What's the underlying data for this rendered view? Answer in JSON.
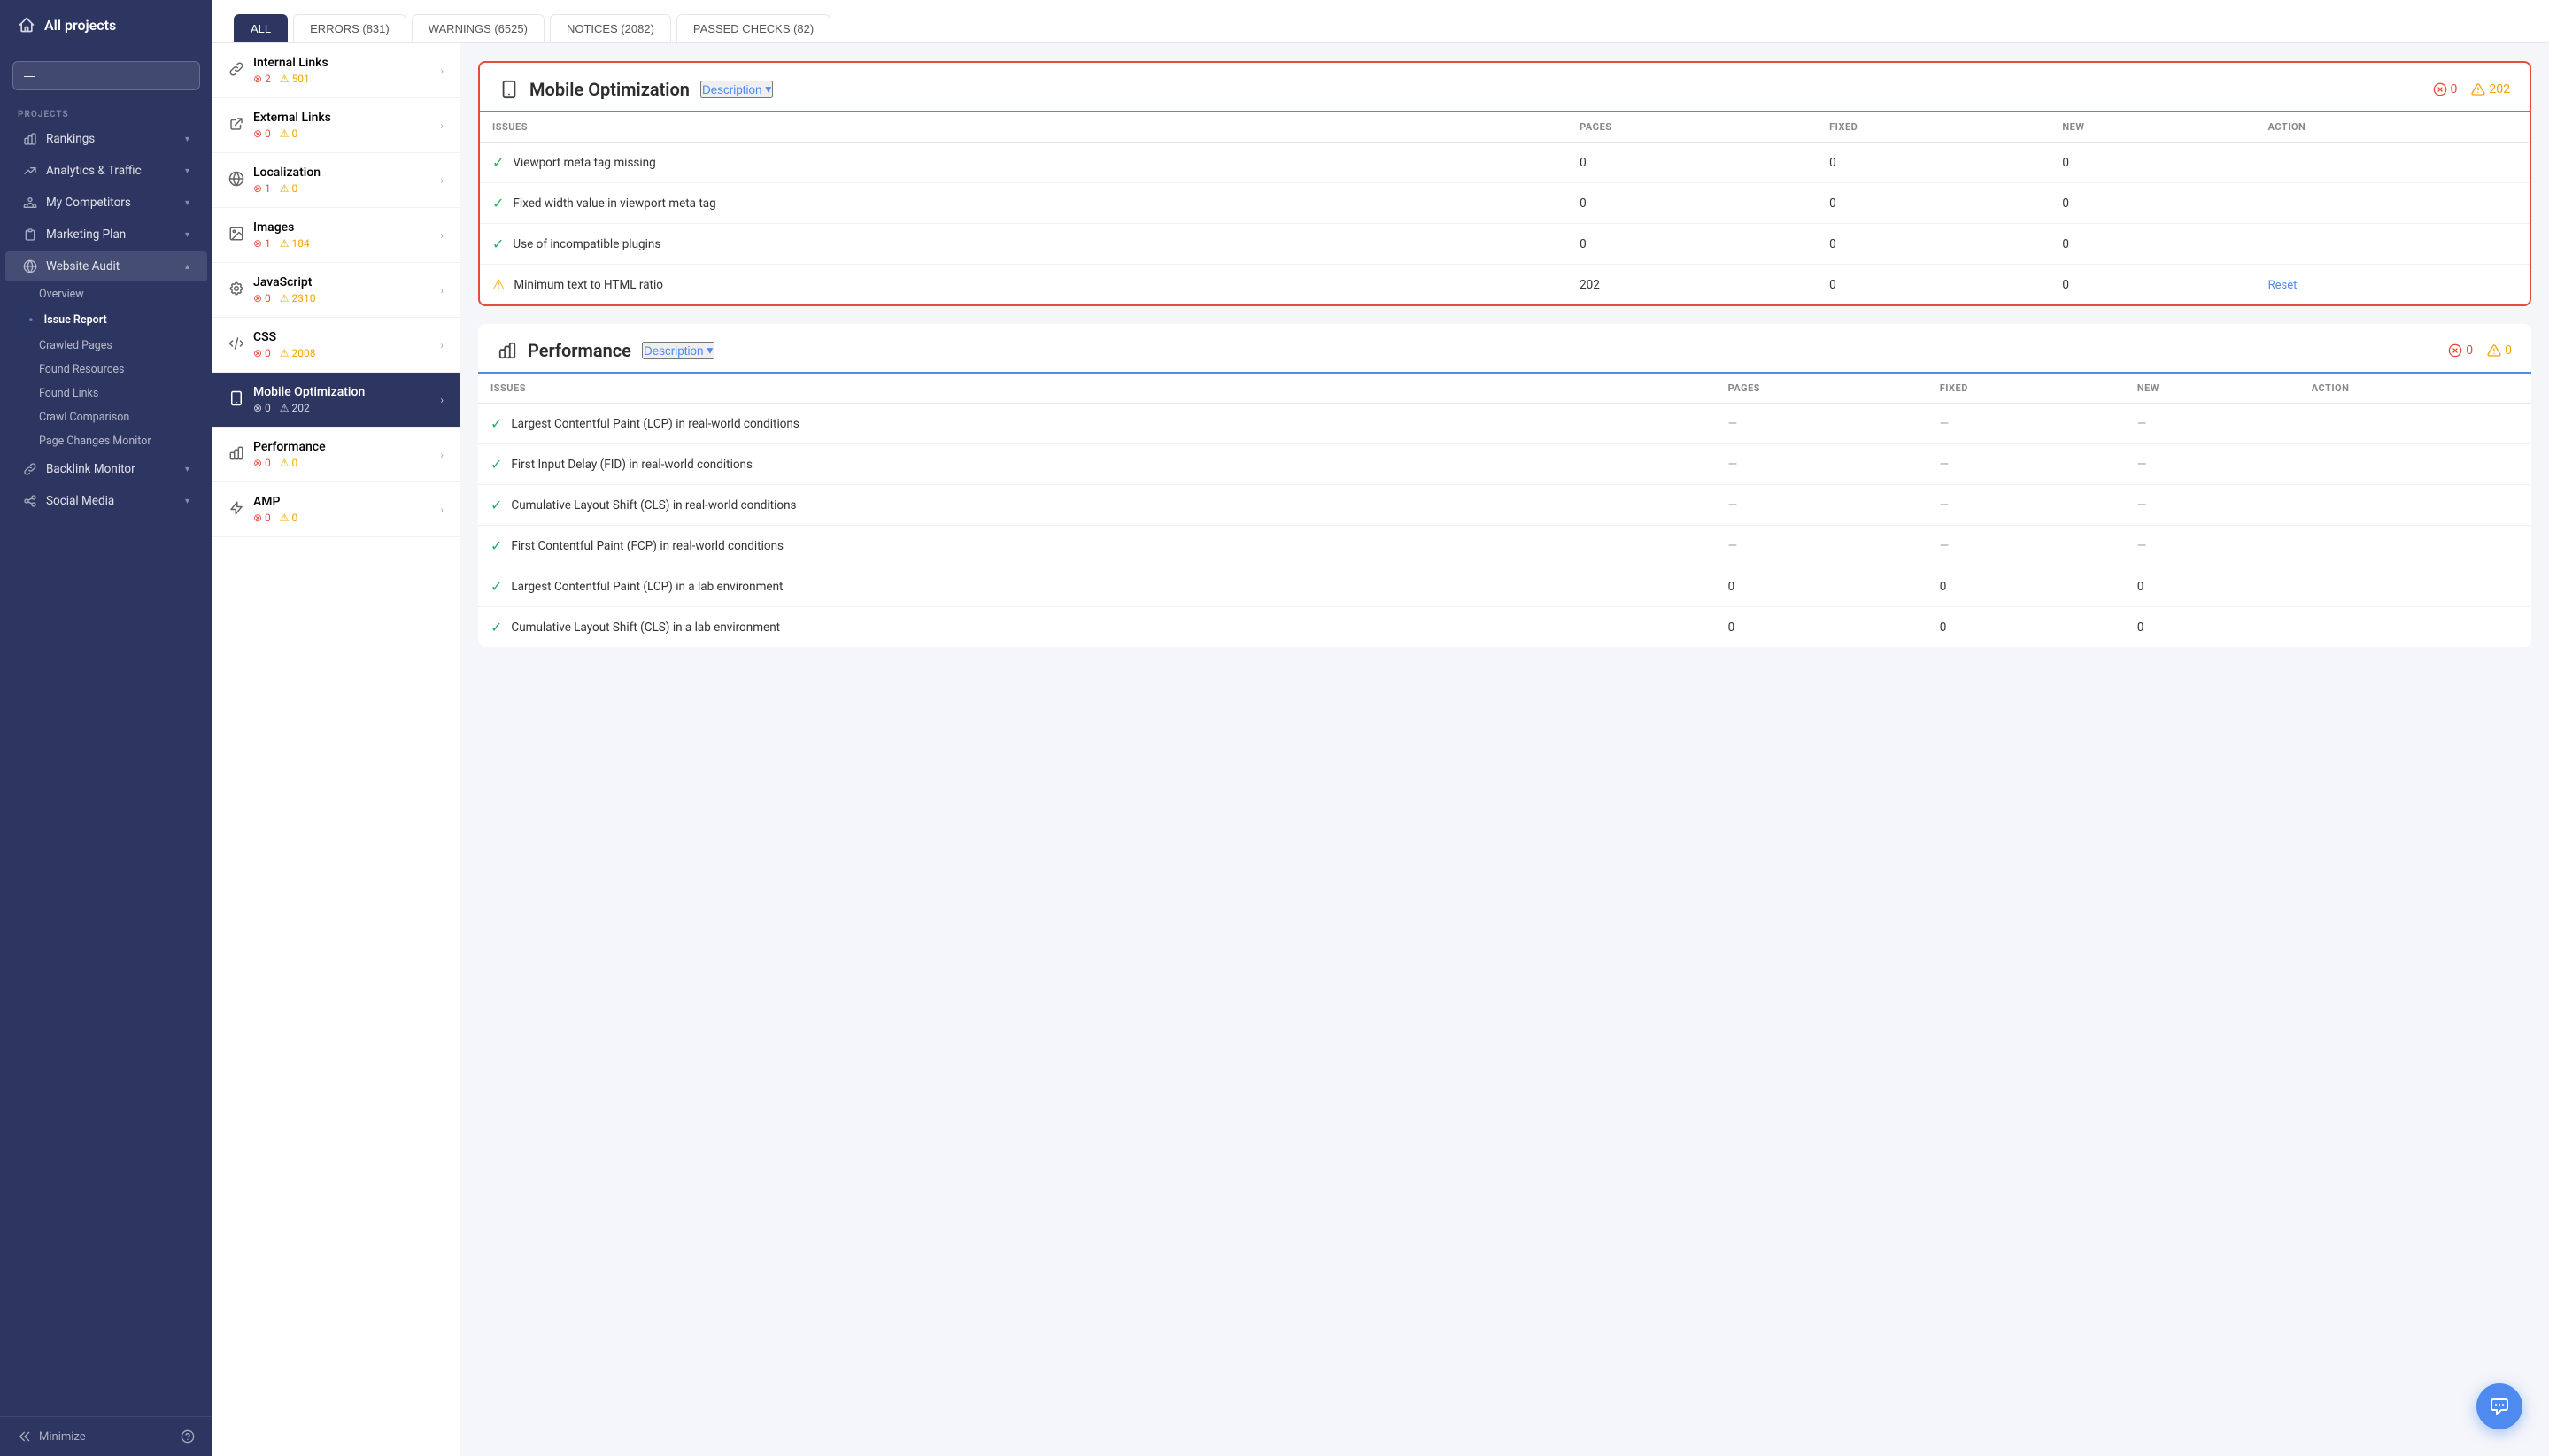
{
  "sidebar": {
    "title": "All projects",
    "section_label": "PROJECTS",
    "dropdown_placeholder": "—",
    "items": [
      {
        "id": "rankings",
        "label": "Rankings",
        "icon": "bar-chart"
      },
      {
        "id": "analytics",
        "label": "Analytics & Traffic",
        "icon": "wave"
      },
      {
        "id": "competitors",
        "label": "My Competitors",
        "icon": "users"
      },
      {
        "id": "marketing",
        "label": "Marketing Plan",
        "icon": "calendar"
      },
      {
        "id": "website-audit",
        "label": "Website Audit",
        "icon": "globe",
        "active": true,
        "sub": [
          {
            "id": "overview",
            "label": "Overview"
          },
          {
            "id": "issue-report",
            "label": "Issue Report",
            "active": true
          },
          {
            "id": "crawled-pages",
            "label": "Crawled Pages"
          },
          {
            "id": "found-resources",
            "label": "Found Resources"
          },
          {
            "id": "found-links",
            "label": "Found Links"
          },
          {
            "id": "crawl-comparison",
            "label": "Crawl Comparison"
          },
          {
            "id": "page-changes",
            "label": "Page Changes Monitor"
          }
        ]
      },
      {
        "id": "backlink-monitor",
        "label": "Backlink Monitor",
        "icon": "link"
      },
      {
        "id": "social-media",
        "label": "Social Media",
        "icon": "share"
      }
    ],
    "minimize": "Minimize"
  },
  "tabs": [
    {
      "id": "all",
      "label": "ALL",
      "active": true
    },
    {
      "id": "errors",
      "label": "ERRORS (831)"
    },
    {
      "id": "warnings",
      "label": "WARNINGS (6525)"
    },
    {
      "id": "notices",
      "label": "NOTICES (2082)"
    },
    {
      "id": "passed",
      "label": "PASSED CHECKS (82)"
    }
  ],
  "left_panel": {
    "items": [
      {
        "id": "internal-links",
        "label": "Internal Links",
        "icon": "🔗",
        "errors": 2,
        "warnings": 501
      },
      {
        "id": "external-links",
        "label": "External Links",
        "icon": "↗",
        "errors": 0,
        "warnings": 0
      },
      {
        "id": "localization",
        "label": "Localization",
        "icon": "🌐",
        "errors": 1,
        "warnings": 0
      },
      {
        "id": "images",
        "label": "Images",
        "icon": "🖼",
        "errors": 1,
        "warnings": 184
      },
      {
        "id": "javascript",
        "label": "JavaScript",
        "icon": "⚙",
        "errors": 0,
        "warnings": 2310
      },
      {
        "id": "css",
        "label": "CSS",
        "icon": "<>",
        "errors": 0,
        "warnings": 2008
      },
      {
        "id": "mobile-optimization",
        "label": "Mobile Optimization",
        "icon": "📱",
        "errors": 0,
        "warnings": 202,
        "active": true
      },
      {
        "id": "performance",
        "label": "Performance",
        "icon": "⚡",
        "errors": 0,
        "warnings": 0
      },
      {
        "id": "amp",
        "label": "AMP",
        "icon": "⚡",
        "errors": 0,
        "warnings": 0
      }
    ]
  },
  "mobile_card": {
    "title": "Mobile Optimization",
    "description_label": "Description",
    "error_count": 0,
    "warning_count": 202,
    "columns": [
      "ISSUES",
      "PAGES",
      "FIXED",
      "NEW",
      "ACTION"
    ],
    "rows": [
      {
        "icon": "ok",
        "issue": "Viewport meta tag missing",
        "pages": "0",
        "fixed": "0",
        "new": "0",
        "action": ""
      },
      {
        "icon": "ok",
        "issue": "Fixed width value in viewport meta tag",
        "pages": "0",
        "fixed": "0",
        "new": "0",
        "action": ""
      },
      {
        "icon": "ok",
        "issue": "Use of incompatible plugins",
        "pages": "0",
        "fixed": "0",
        "new": "0",
        "action": ""
      },
      {
        "icon": "warn",
        "issue": "Minimum text to HTML ratio",
        "pages": "202",
        "fixed": "0",
        "new": "0",
        "action": "Reset"
      }
    ]
  },
  "performance_card": {
    "title": "Performance",
    "description_label": "Description",
    "error_count": 0,
    "warning_count": 0,
    "columns": [
      "ISSUES",
      "PAGES",
      "FIXED",
      "NEW",
      "ACTION"
    ],
    "rows": [
      {
        "icon": "ok",
        "issue": "Largest Contentful Paint (LCP) in real-world conditions",
        "pages": "—",
        "fixed": "—",
        "new": "—",
        "action": ""
      },
      {
        "icon": "ok",
        "issue": "First Input Delay (FID) in real-world conditions",
        "pages": "—",
        "fixed": "—",
        "new": "—",
        "action": ""
      },
      {
        "icon": "ok",
        "issue": "Cumulative Layout Shift (CLS) in real-world conditions",
        "pages": "—",
        "fixed": "—",
        "new": "—",
        "action": ""
      },
      {
        "icon": "ok",
        "issue": "First Contentful Paint (FCP) in real-world conditions",
        "pages": "—",
        "fixed": "—",
        "new": "—",
        "action": ""
      },
      {
        "icon": "ok",
        "issue": "Largest Contentful Paint (LCP) in a lab environment",
        "pages": "0",
        "fixed": "0",
        "new": "0",
        "action": ""
      },
      {
        "icon": "ok",
        "issue": "Cumulative Layout Shift (CLS) in a lab environment",
        "pages": "0",
        "fixed": "0",
        "new": "0",
        "action": ""
      }
    ]
  }
}
